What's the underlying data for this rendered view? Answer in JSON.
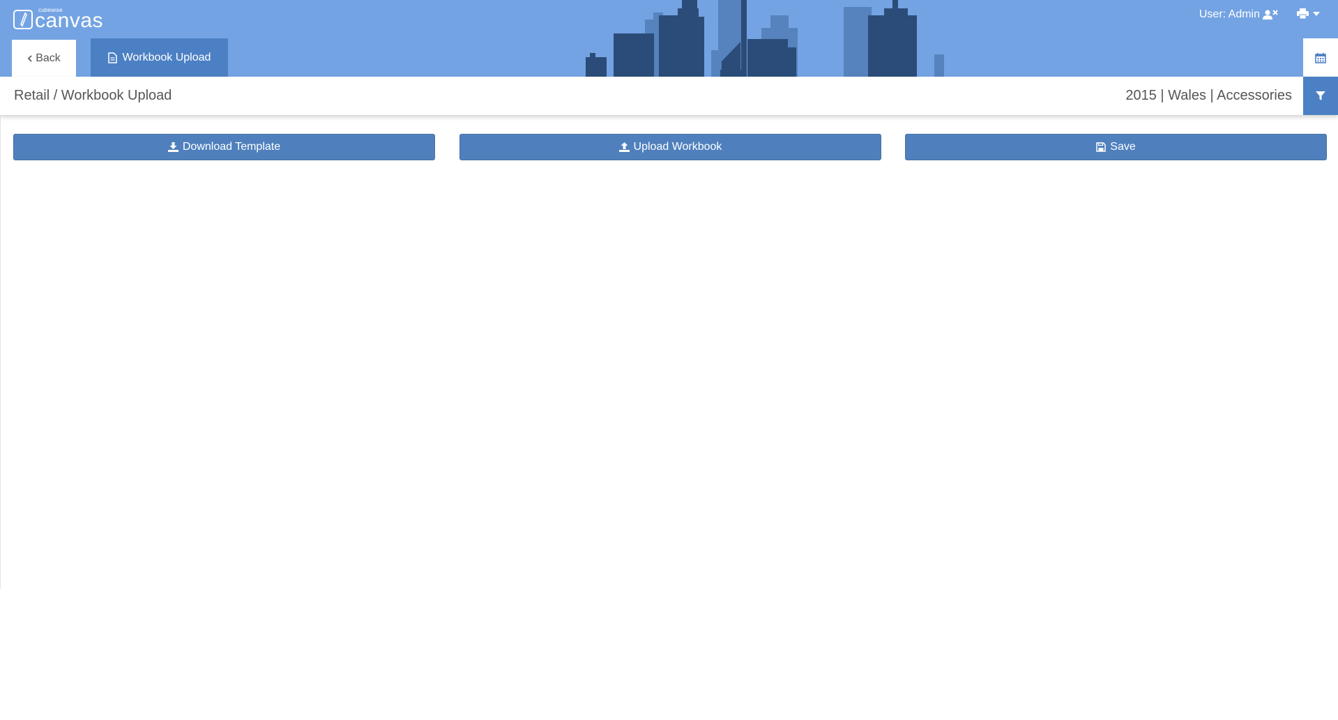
{
  "app": {
    "brand_small": "cubewise",
    "brand_name": "canvas"
  },
  "header": {
    "user_label": "User: Admin",
    "user_icon": "user-times-icon",
    "print_icon": "printer-icon",
    "calendar_icon": "calendar-icon"
  },
  "tabs": {
    "back_label": "Back",
    "active_label": "Workbook Upload",
    "active_icon": "file-icon"
  },
  "subbar": {
    "breadcrumb": "Retail / Workbook Upload",
    "context": "2015 | Wales | Accessories",
    "filter_icon": "filter-icon"
  },
  "actions": {
    "download_label": "Download Template",
    "upload_label": "Upload Workbook",
    "save_label": "Save"
  },
  "colors": {
    "header_bg": "#73a3e3",
    "accent": "#4c80c4",
    "skyline_dark": "#2b4c78",
    "skyline_mid": "#5683bd"
  }
}
